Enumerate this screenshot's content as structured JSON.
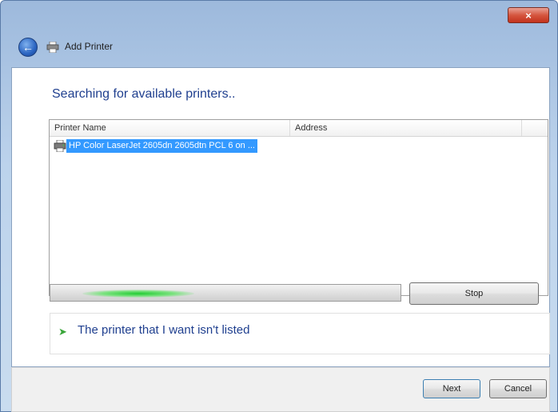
{
  "window": {
    "title": "Add Printer",
    "close_glyph": "×"
  },
  "content": {
    "heading": "Searching for available printers..",
    "list": {
      "columns": [
        "Printer Name",
        "Address"
      ],
      "rows": [
        {
          "name": "HP Color LaserJet 2605dn 2605dtn PCL 6 on ...",
          "address": "",
          "icon": "printer-icon",
          "selected": true
        }
      ]
    },
    "progress": {
      "indeterminate": true,
      "color": "#22cc33"
    },
    "stop_label": "Stop",
    "link_label": "The printer that I want isn't listed"
  },
  "footer": {
    "next_label": "Next",
    "cancel_label": "Cancel"
  }
}
